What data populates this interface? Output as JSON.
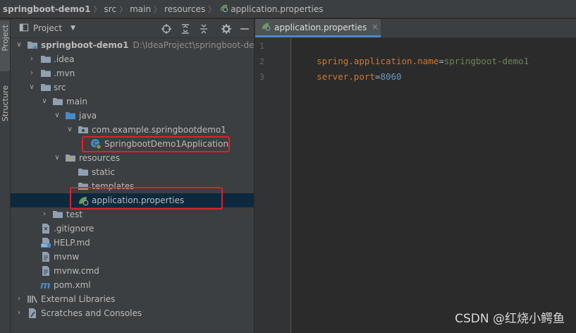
{
  "breadcrumb": {
    "project": "springboot-demo1",
    "src": "src",
    "main": "main",
    "resources": "resources",
    "file": "application.properties"
  },
  "tool_strip": {
    "project_tab": "Project",
    "structure_tab": "Structure"
  },
  "panel": {
    "title": "Project"
  },
  "tree": {
    "root_name": "springboot-demo1",
    "root_path": "D:\\IdeaProject\\springboot-dem",
    "idea": ".idea",
    "mvn": ".mvn",
    "src": "src",
    "main": "main",
    "java": "java",
    "package": "com.example.springbootdemo1",
    "app_class": "SpringbootDemo1Application",
    "resources": "resources",
    "static": "static",
    "templates": "templates",
    "app_props": "application.properties",
    "test": "test",
    "gitignore": ".gitignore",
    "help": "HELP.md",
    "mvnw": "mvnw",
    "mvnw_cmd": "mvnw.cmd",
    "pom": "pom.xml",
    "ext_libs": "External Libraries",
    "scratches": "Scratches and Consoles"
  },
  "editor": {
    "tab_label": "application.properties",
    "line_numbers": [
      "1",
      "2",
      "3"
    ],
    "line1": {
      "key": "spring.application.name",
      "eq": "=",
      "value": "springboot-demo1"
    },
    "line2": {
      "key": "server.port",
      "eq": "=",
      "value": "8060"
    }
  },
  "watermark": "CSDN @红烧小鳄鱼",
  "colors": {
    "selection": "#0d293e",
    "highlight_border": "#e0202b",
    "tab_underline": "#4a88c7",
    "key": "#cc7832",
    "string_value": "#6a8759",
    "number_value": "#6897bb"
  },
  "icons": [
    "folder-icon",
    "module-folder-icon",
    "source-folder-icon",
    "resources-folder-icon",
    "package-icon",
    "spring-class-icon",
    "spring-leaf-icon",
    "file-icon",
    "markdown-icon",
    "maven-icon",
    "libraries-icon",
    "scratches-icon",
    "crosshair-icon",
    "expand-all-icon",
    "collapse-all-icon",
    "gear-icon",
    "minimize-icon",
    "close-icon"
  ]
}
